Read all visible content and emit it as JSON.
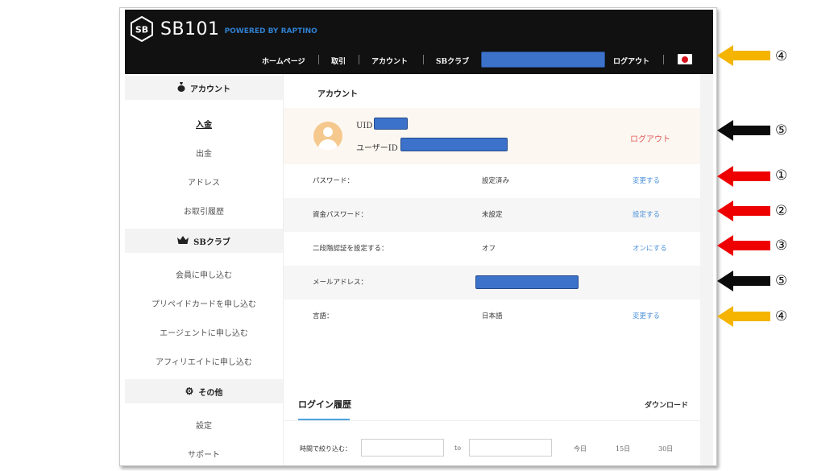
{
  "brand": {
    "name": "SB101",
    "tagline": "POWERED BY RAPTINO",
    "mark": "SB"
  },
  "nav": {
    "home": "ホームページ",
    "trade": "取引",
    "account": "アカウント",
    "club": "SBクラブ",
    "logout": "ログアウト"
  },
  "sidebar": {
    "account_head": "アカウント",
    "account_items": [
      "入金",
      "出金",
      "アドレス",
      "お取引履歴"
    ],
    "club_head": "SBクラブ",
    "club_items": [
      "会員に申し込む",
      "プリペイドカードを申し込む",
      "エージェントに申し込む",
      "アフィリエイトに申し込む"
    ],
    "other_head": "その他",
    "other_items": [
      "設定",
      "サポート"
    ]
  },
  "main": {
    "title": "アカウント",
    "uid_label": "UID",
    "userid_label": "ユーザーID",
    "logout_label": "ログアウト",
    "rows": [
      {
        "label": "パスワード：",
        "value": "設定済み",
        "action": "変更する"
      },
      {
        "label": "資金パスワード：",
        "value": "未設定",
        "action": "設定する"
      },
      {
        "label": "二段階認証を設定する：",
        "value": "オフ",
        "action": "オンにする"
      },
      {
        "label": "メールアドレス：",
        "value": "",
        "action": ""
      },
      {
        "label": "言語：",
        "value": "日本語",
        "action": "変更する"
      }
    ],
    "login_history": {
      "title": "ログイン履歴",
      "download": "ダウンロード",
      "filter_label": "時間で絞り込む：",
      "to": "to",
      "quick": [
        "今日",
        "15日",
        "30日"
      ]
    }
  },
  "annotations": [
    "④",
    "⑤",
    "①",
    "②",
    "③",
    "⑤",
    "④"
  ],
  "colors": {
    "yellow_arrow": "#f4b400",
    "black_arrow": "#0b0b0b",
    "red_arrow": "#ee0000",
    "redaction": "#3c72c9"
  }
}
